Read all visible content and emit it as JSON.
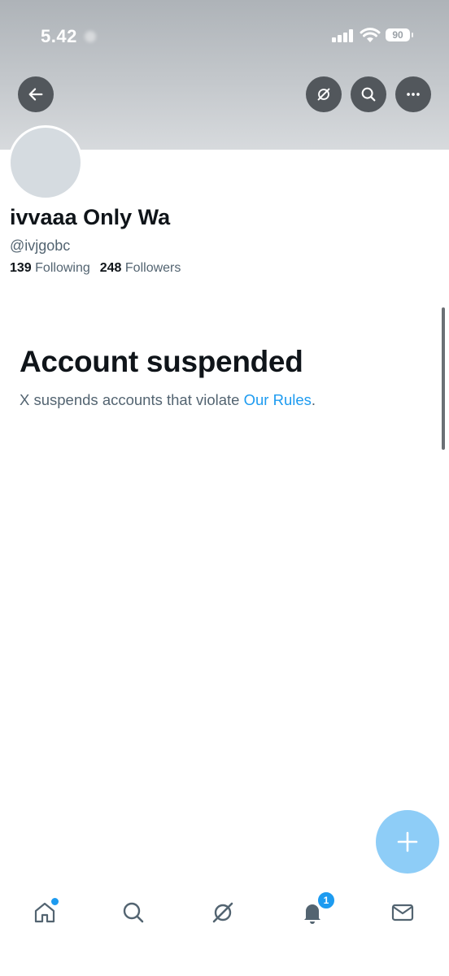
{
  "status_bar": {
    "time": "5.42",
    "battery": "90",
    "icons": [
      "signal-icon",
      "wifi-icon",
      "battery-icon"
    ]
  },
  "header": {
    "buttons": [
      "back-arrow-icon",
      "grok-icon",
      "search-icon",
      "more-icon"
    ]
  },
  "profile": {
    "display_name": "ivvaaa Only Wa",
    "handle": "@ivjgobc",
    "following_count": "139",
    "following_label": "Following",
    "followers_count": "248",
    "followers_label": "Followers"
  },
  "suspension": {
    "title": "Account suspended",
    "message": "X suspends accounts that violate ",
    "link": "Our Rules",
    "suffix": "."
  },
  "fab": {
    "icon": "plus-icon"
  },
  "bottom_nav": {
    "items": [
      "home-icon",
      "search-icon",
      "grok-icon",
      "bell-icon",
      "mail-icon"
    ],
    "notification_badge": "1"
  },
  "colors": {
    "accent": "#1d9bf0",
    "fab": "#8ecdf7",
    "text": "#0f1419",
    "secondary_text": "#536471"
  }
}
